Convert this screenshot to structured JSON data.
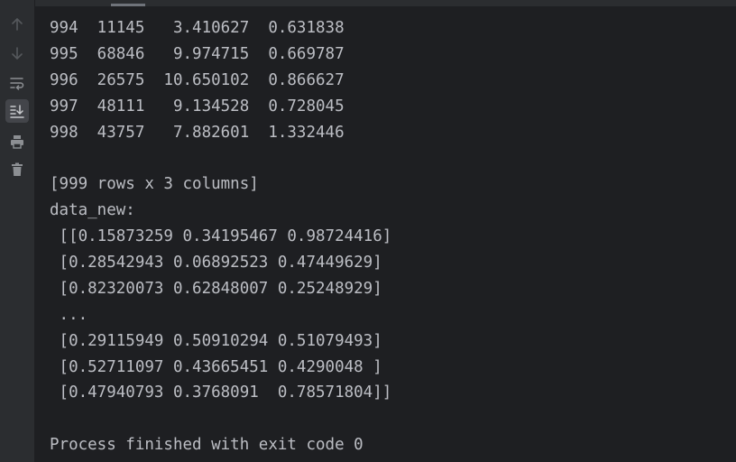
{
  "console": {
    "top_cut_line": "...   ...        ...       ...",
    "rows": [
      "994  11145   3.410627  0.631838",
      "995  68846   9.974715  0.669787",
      "996  26575  10.650102  0.866627",
      "997  48111   9.134528  0.728045",
      "998  43757   7.882601  1.332446"
    ],
    "summary": "[999 rows x 3 columns]",
    "array_label": "data_new:",
    "array_lines": [
      " [[0.15873259 0.34195467 0.98724416]",
      " [0.28542943 0.06892523 0.47449629]",
      " [0.82320073 0.62848007 0.25248929]",
      " ...",
      " [0.29115949 0.50910294 0.51079493]",
      " [0.52711097 0.43665451 0.4290048 ]",
      " [0.47940793 0.3768091  0.78571804]]"
    ],
    "exit_message": "Process finished with exit code 0"
  },
  "toolbar": {
    "icons": [
      "arrow-up-icon",
      "arrow-down-icon",
      "soft-wrap-icon",
      "scroll-to-end-icon",
      "print-icon",
      "trash-icon"
    ]
  }
}
